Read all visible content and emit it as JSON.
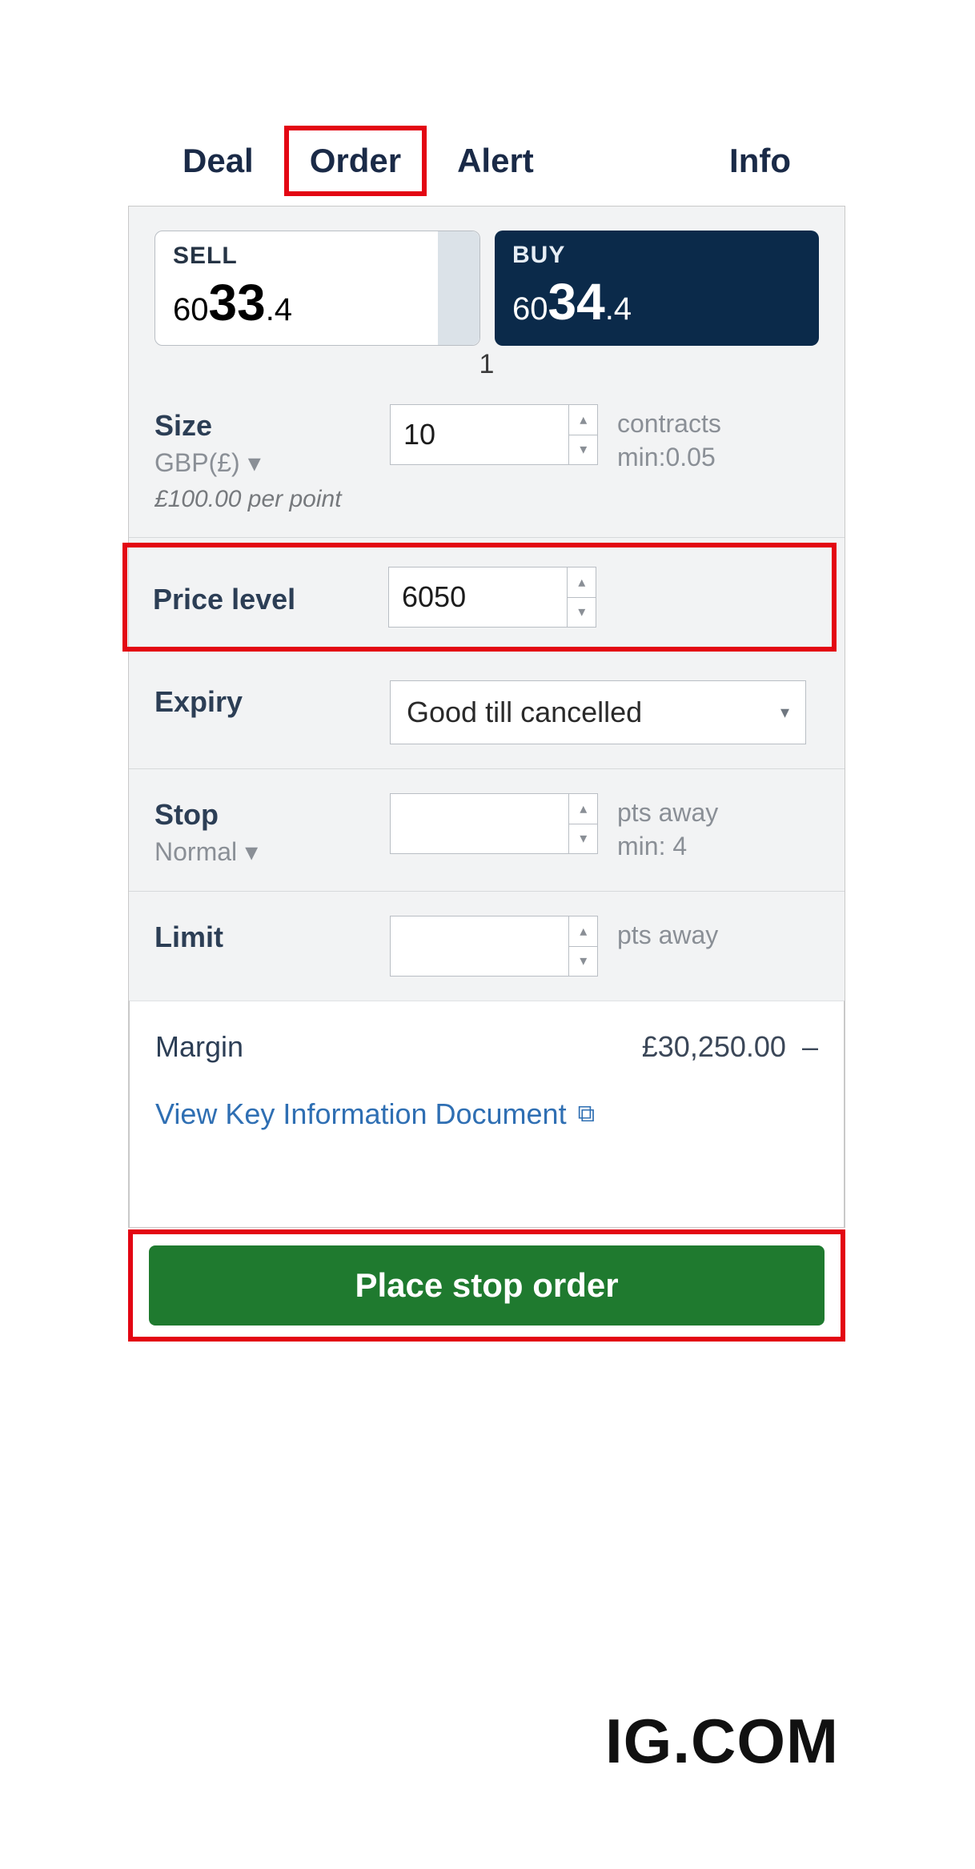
{
  "tabs": {
    "deal": "Deal",
    "order": "Order",
    "alert": "Alert",
    "info": "Info"
  },
  "prices": {
    "sell_label": "SELL",
    "sell_prefix": "60",
    "sell_big": "33",
    "sell_frac": ".4",
    "buy_label": "BUY",
    "buy_prefix": "60",
    "buy_big": "34",
    "buy_frac": ".4",
    "spread": "1"
  },
  "size": {
    "label": "Size",
    "currency": "GBP(£)",
    "value": "10",
    "unit": "contracts",
    "min": "min:0.05",
    "per_point": "£100.00 per point"
  },
  "price_level": {
    "label": "Price level",
    "value": "6050"
  },
  "expiry": {
    "label": "Expiry",
    "value": "Good till cancelled"
  },
  "stop": {
    "label": "Stop",
    "type": "Normal",
    "value": "",
    "unit": "pts away",
    "min": "min: 4"
  },
  "limit": {
    "label": "Limit",
    "value": "",
    "unit": "pts away"
  },
  "margin": {
    "label": "Margin",
    "value": "£30,250.00",
    "suffix": "–"
  },
  "kid_link": "View Key Information Document",
  "submit": "Place stop order",
  "brand": "IG.COM"
}
